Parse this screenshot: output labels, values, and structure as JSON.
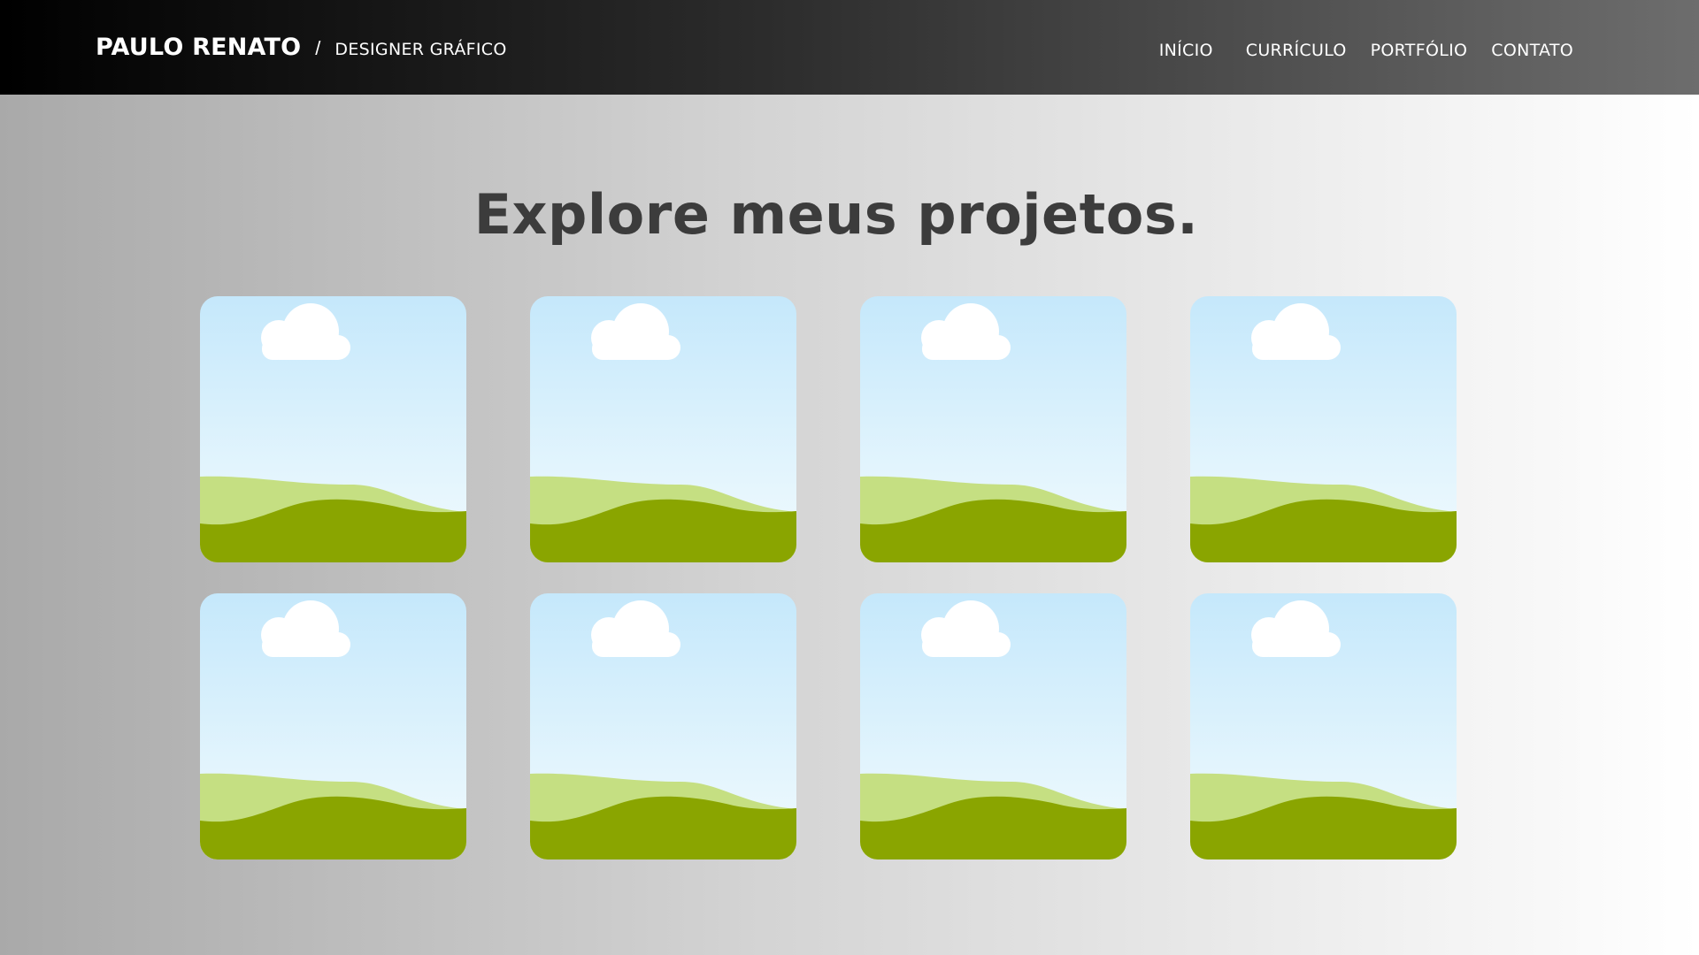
{
  "header": {
    "name": "PAULO RENATO",
    "separator": "/",
    "role": "DESIGNER GRÁFICO",
    "nav": [
      {
        "label": "INÍCIO"
      },
      {
        "label": "CURRÍCULO"
      },
      {
        "label": "PORTFÓLIO"
      },
      {
        "label": "CONTATO"
      }
    ]
  },
  "main": {
    "headline": "Explore meus projetos.",
    "projects": [
      {
        "icon": "image-placeholder-icon"
      },
      {
        "icon": "image-placeholder-icon"
      },
      {
        "icon": "image-placeholder-icon"
      },
      {
        "icon": "image-placeholder-icon"
      },
      {
        "icon": "image-placeholder-icon"
      },
      {
        "icon": "image-placeholder-icon"
      },
      {
        "icon": "image-placeholder-icon"
      },
      {
        "icon": "image-placeholder-icon"
      }
    ]
  },
  "colors": {
    "sky_top": "#c5e8fb",
    "sky_bottom": "#f2fbfe",
    "hill_light": "#c5df82",
    "hill_dark": "#8aa500",
    "cloud": "#ffffff",
    "headline": "#3c3c3c"
  }
}
